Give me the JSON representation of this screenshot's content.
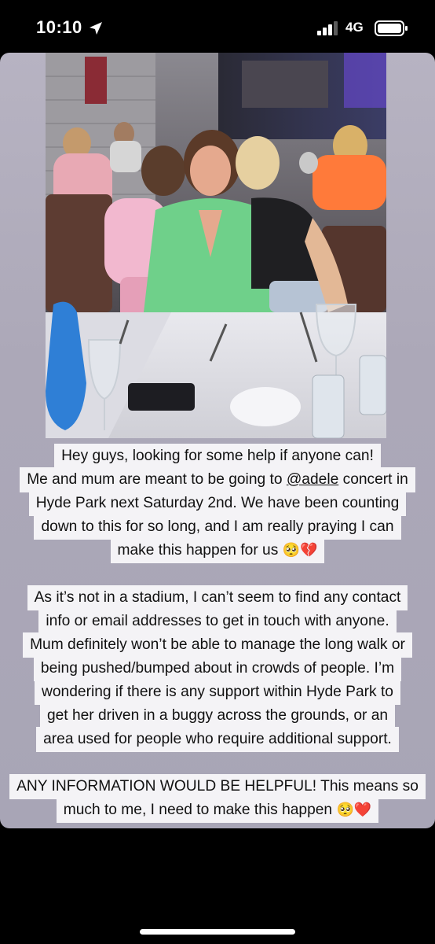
{
  "status_bar": {
    "time": "10:10",
    "network": "4G",
    "icons": [
      "location-arrow-icon",
      "signal-bars-icon",
      "battery-icon"
    ]
  },
  "story": {
    "line1": "Hey guys, looking for some help if anyone can!",
    "line2_pre": "Me and mum are meant to be going to ",
    "line2_mention": "@adele",
    "line2_post": " concert in",
    "line3": "Hyde Park next Saturday 2nd. We have been counting",
    "line4": "down to this for so long, and I am really praying I can",
    "line5": "make this happen for us",
    "line5_emoji": "🥺💔",
    "line6": "As it’s not in a stadium, I can’t seem to find any contact",
    "line7": "info or email addresses to get in touch with anyone.",
    "line8": "Mum definitely won’t be able to manage the long walk or",
    "line9": "being pushed/bumped about in crowds of people. I’m",
    "line10": "wondering if there is any support within Hyde Park to",
    "line11": "get her driven in a buggy across the grounds, or an",
    "line12": "area used for people who require additional support.",
    "line13": "ANY INFORMATION WOULD BE HELPFUL! This means so",
    "line14": "much to me, I need to make this happen",
    "line14_emoji": "🥺❤️"
  },
  "colors": {
    "story_bg": "#aca8b8",
    "text_bg": "#f4f3f6",
    "dress_green": "#6fd08a",
    "top_pink": "#f2b8cf",
    "top_orange": "#ff7a3a"
  }
}
